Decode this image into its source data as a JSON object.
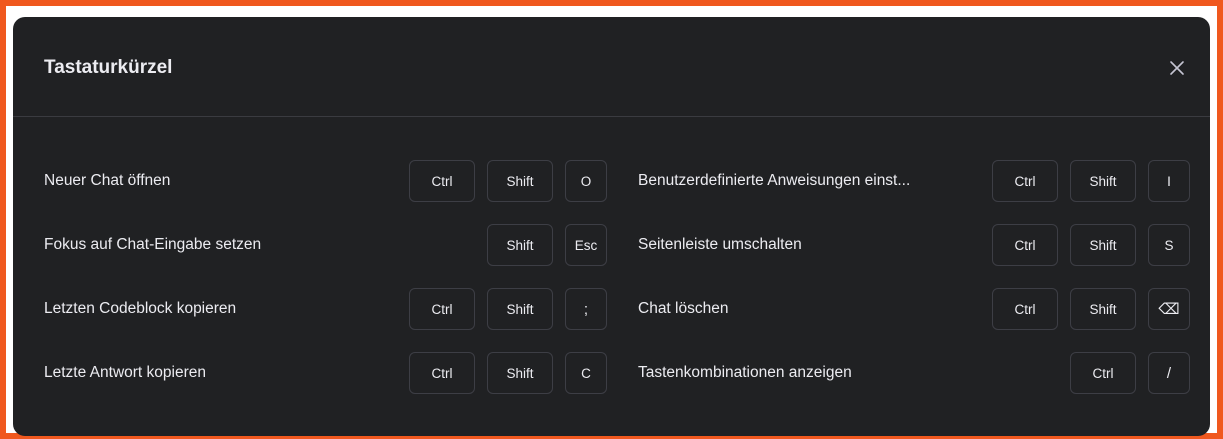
{
  "modal": {
    "title": "Tastaturkürzel",
    "close_icon": "close-icon"
  },
  "shortcuts_left": [
    {
      "label": "Neuer Chat öffnen",
      "keys": [
        "Ctrl",
        "Shift",
        "O"
      ]
    },
    {
      "label": "Fokus auf Chat-Eingabe setzen",
      "keys": [
        "Shift",
        "Esc"
      ]
    },
    {
      "label": "Letzten Codeblock kopieren",
      "keys": [
        "Ctrl",
        "Shift",
        ";"
      ]
    },
    {
      "label": "Letzte Antwort kopieren",
      "keys": [
        "Ctrl",
        "Shift",
        "C"
      ]
    }
  ],
  "shortcuts_right": [
    {
      "label": "Benutzerdefinierte Anweisungen einst...",
      "keys": [
        "Ctrl",
        "Shift",
        "I"
      ]
    },
    {
      "label": "Seitenleiste umschalten",
      "keys": [
        "Ctrl",
        "Shift",
        "S"
      ]
    },
    {
      "label": "Chat löschen",
      "keys": [
        "Ctrl",
        "Shift",
        "⌫"
      ]
    },
    {
      "label": "Tastenkombinationen anzeigen",
      "keys": [
        "Ctrl",
        "/"
      ]
    }
  ],
  "colors": {
    "border_accent": "#f0581e",
    "modal_bg": "#202123",
    "text": "#ececf1",
    "key_border": "#3d3e45"
  }
}
